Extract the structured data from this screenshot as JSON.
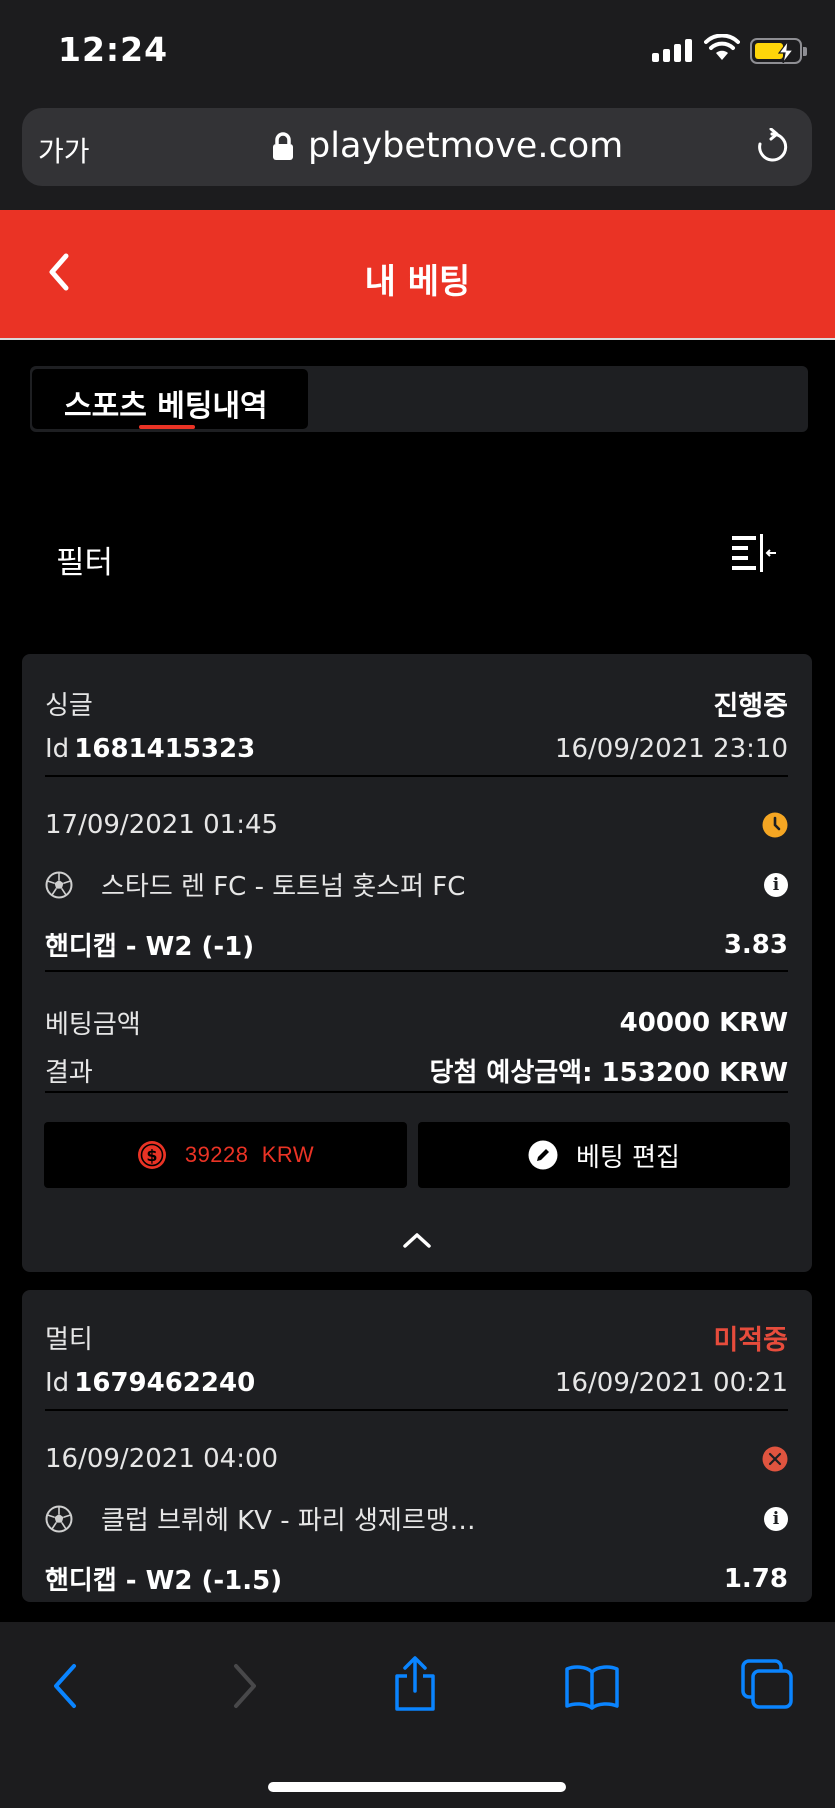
{
  "status_bar": {
    "time": "12:24"
  },
  "browser": {
    "text_size_button": "가가",
    "url": "playbetmove.com"
  },
  "header": {
    "title": "내 베팅"
  },
  "tabs": [
    {
      "label": "스포츠 베팅내역",
      "active": true
    }
  ],
  "filter": {
    "label": "필터"
  },
  "bets": [
    {
      "type": "싱글",
      "status": "진행중",
      "id_label": "Id",
      "id": "1681415323",
      "placed_at": "16/09/2021 23:10",
      "event_time": "17/09/2021 01:45",
      "match": "스타드 렌 FC - 토트넘 홋스퍼 FC",
      "market": "핸디캡 - W2 (-1)",
      "odds": "3.83",
      "stake_label": "베팅금액",
      "stake": "40000 KRW",
      "result_label": "결과",
      "potential_win": "당첨 예상금액: 153200 KRW",
      "cashout": "39228  KRW",
      "edit_label": "베팅 편집"
    },
    {
      "type": "멀티",
      "status": "미적중",
      "id_label": "Id",
      "id": "1679462240",
      "placed_at": "16/09/2021 00:21",
      "event_time": "16/09/2021 04:00",
      "match": "클럽 브뤼헤 KV - 파리 생제르맹…",
      "market": "핸디캡 - W2 (-1.5)",
      "odds": "1.78"
    }
  ],
  "colors": {
    "accent": "#ea3325",
    "pending_clock": "#f5a623",
    "lost": "#e74c3c",
    "safari_blue": "#0a84ff"
  }
}
